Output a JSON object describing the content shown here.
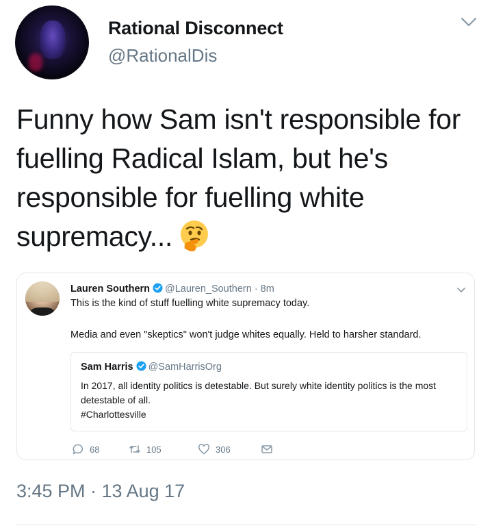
{
  "author": {
    "display_name": "Rational Disconnect",
    "handle": "@RationalDis"
  },
  "tweet": {
    "text": "Funny how Sam isn't responsible for fuelling Radical Islam, but he's responsible for fuelling white supremacy...",
    "emoji": "thinking-face-emoji",
    "timestamp": "3:45 PM · 13 Aug 17"
  },
  "quoted": {
    "name": "Lauren Southern",
    "handle_time": "@Lauren_Southern · 8m",
    "line1": "This is the kind of stuff fuelling white supremacy today.",
    "line2": "Media and even \"skeptics\" won't judge whites equally. Held to harsher standard.",
    "inner": {
      "name": "Sam Harris",
      "handle": "@SamHarrisOrg",
      "text": "In 2017, all identity politics is detestable. But surely white identity politics is the most detestable of all.",
      "hashtag": "#Charlottesville"
    },
    "actions": {
      "replies": "68",
      "retweets": "105",
      "likes": "306"
    }
  },
  "colors": {
    "text": "#14171a",
    "secondary": "#657786",
    "verified": "#1da1f2",
    "border": "#e1e8ed"
  }
}
